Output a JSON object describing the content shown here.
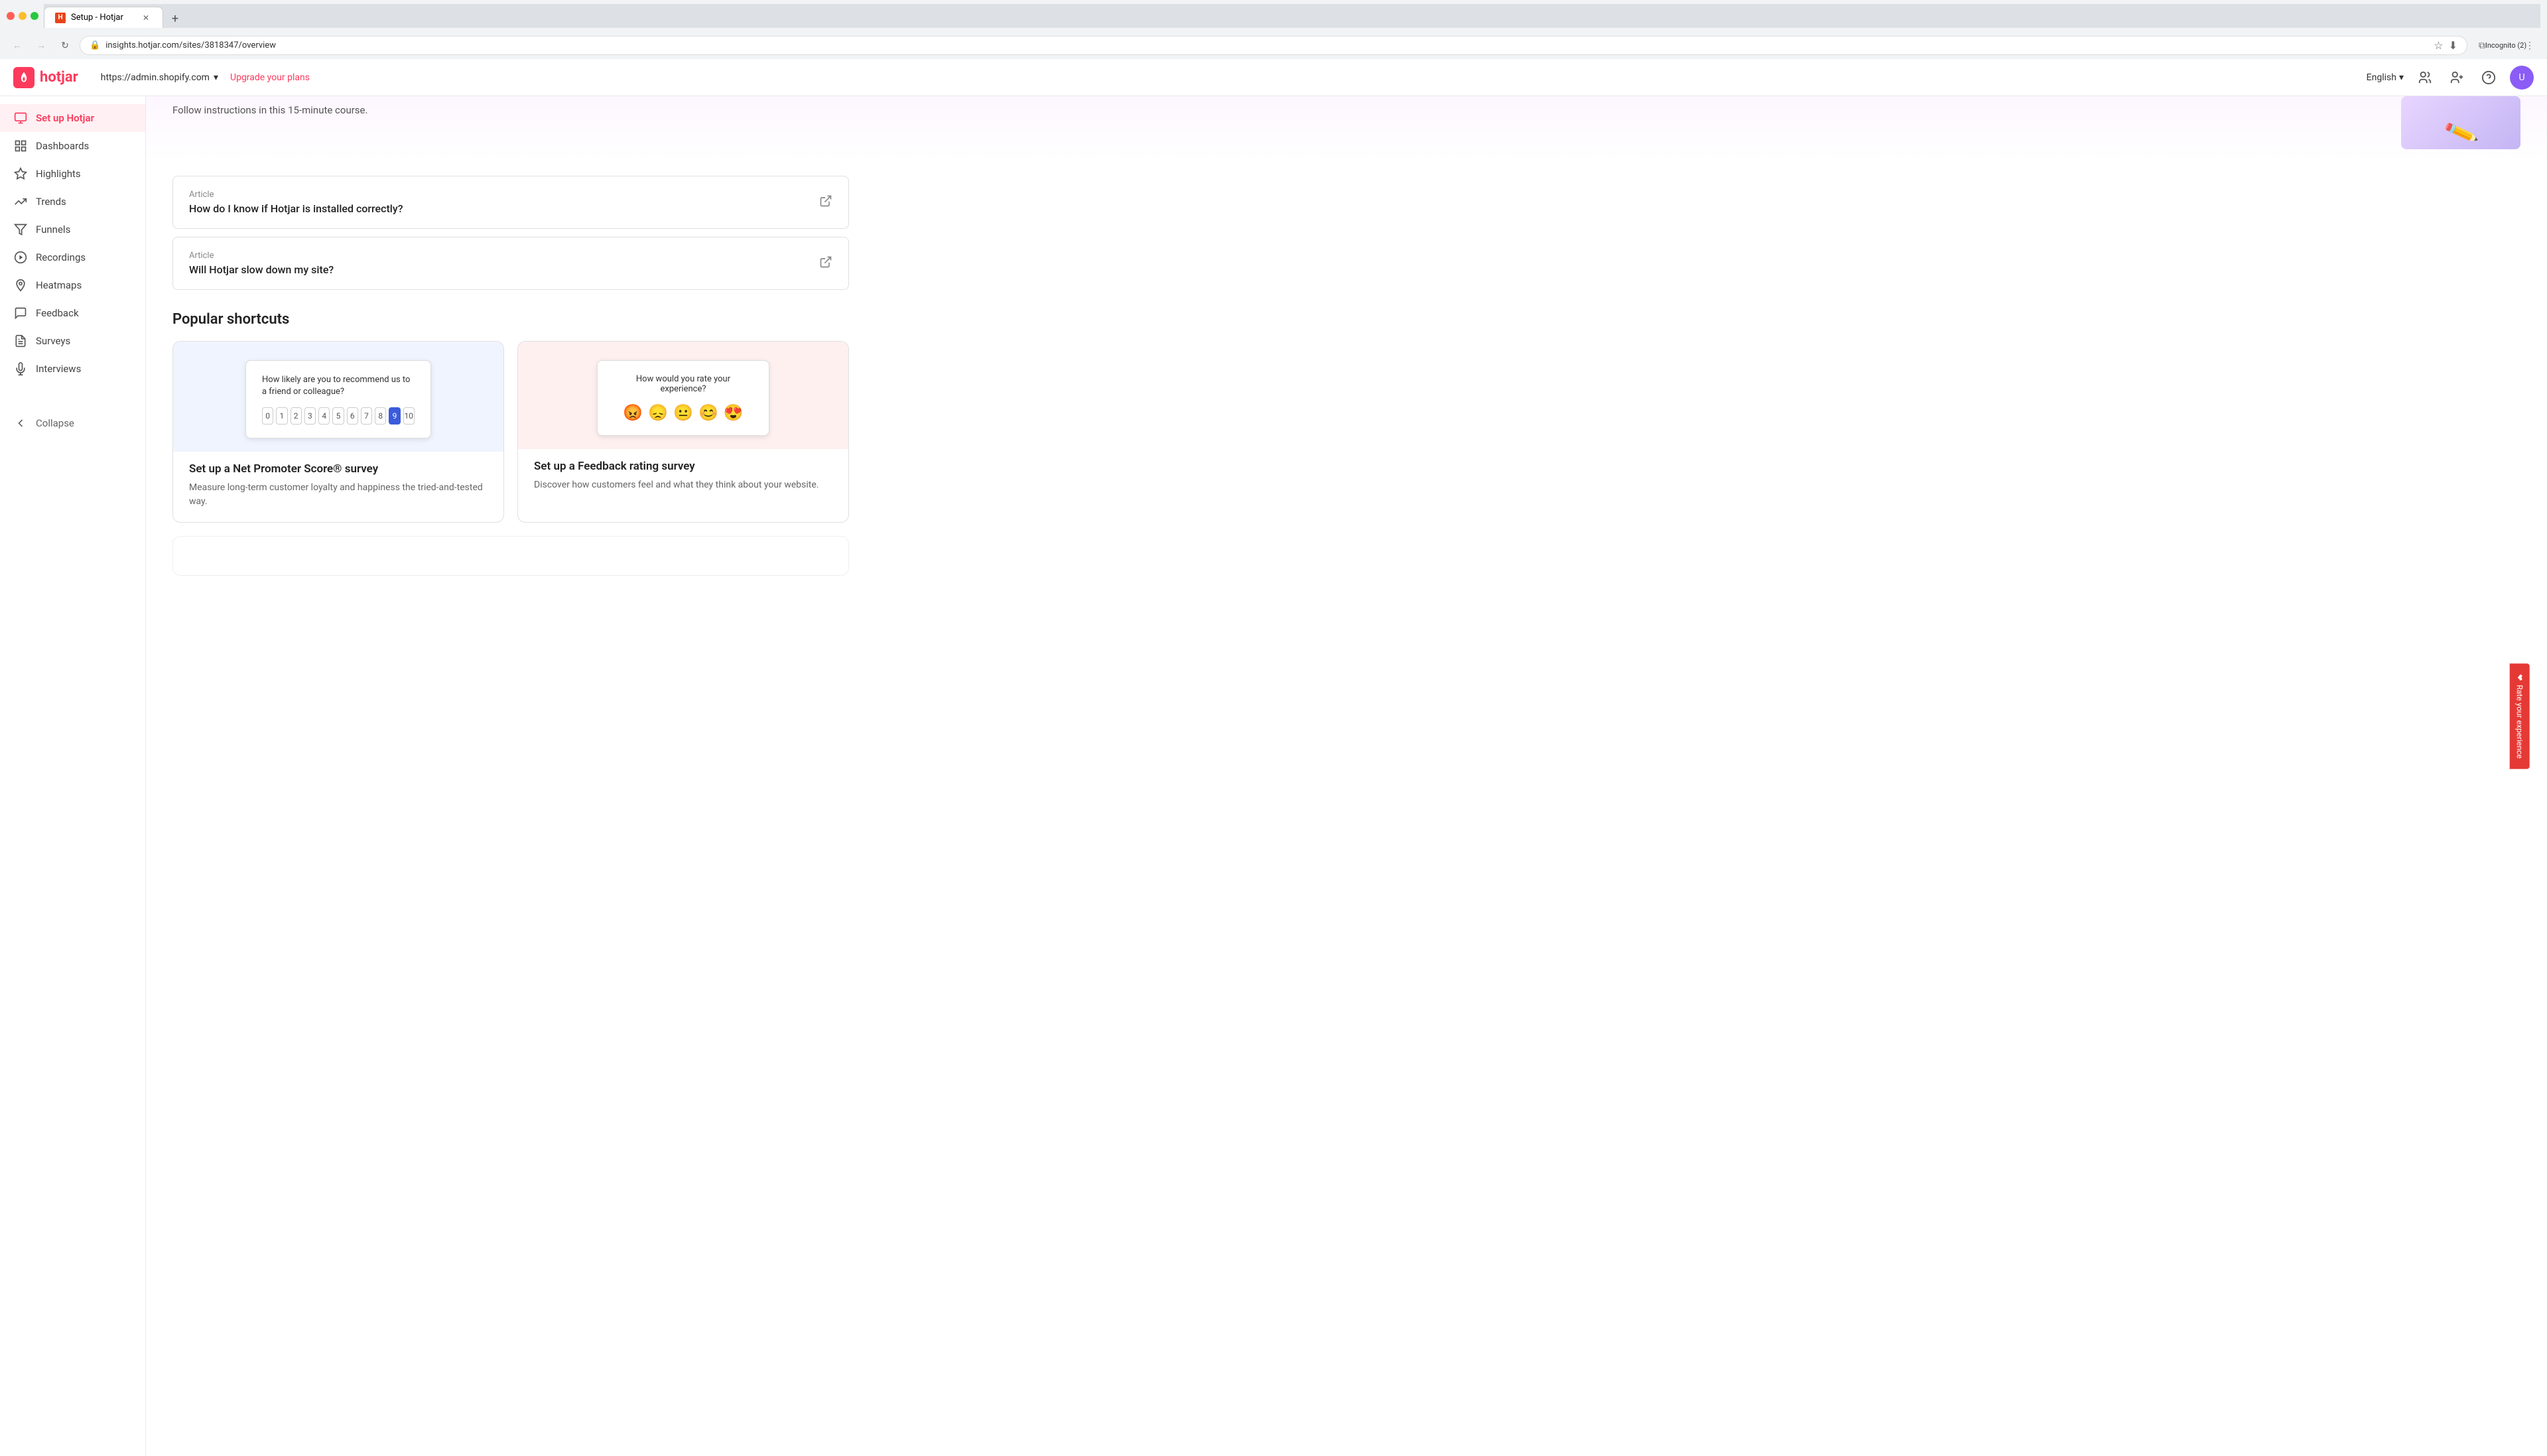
{
  "browser": {
    "tab_title": "Setup - Hotjar",
    "tab_favicon": "H",
    "new_tab_label": "+",
    "url": "insights.hotjar.com/sites/3818347/overview",
    "display_url": "insights.hotjar.com/sites/3818347/overview",
    "nav": {
      "back_icon": "←",
      "forward_icon": "→",
      "reload_icon": "↻"
    },
    "incognito_label": "Incognito (2)"
  },
  "hotjar_topbar": {
    "logo_text": "hotjar",
    "logo_initial": "hj",
    "site_url": "https://admin.shopify.com",
    "site_dropdown_icon": "▾",
    "upgrade_label": "Upgrade your plans",
    "lang_label": "English",
    "lang_dropdown": "▾",
    "icons": {
      "users": "👥",
      "user_add": "👤+",
      "help": "?",
      "avatar_initial": "U"
    }
  },
  "sidebar": {
    "items": [
      {
        "id": "setup",
        "label": "Set up Hotjar",
        "icon": "⚙",
        "active": true
      },
      {
        "id": "dashboards",
        "label": "Dashboards",
        "icon": "▦",
        "active": false
      },
      {
        "id": "highlights",
        "label": "Highlights",
        "icon": "★",
        "active": false
      },
      {
        "id": "trends",
        "label": "Trends",
        "icon": "📈",
        "active": false
      },
      {
        "id": "funnels",
        "label": "Funnels",
        "icon": "⬦",
        "active": false
      },
      {
        "id": "recordings",
        "label": "Recordings",
        "icon": "▶",
        "active": false
      },
      {
        "id": "heatmaps",
        "label": "Heatmaps",
        "icon": "🔥",
        "active": false
      },
      {
        "id": "feedback",
        "label": "Feedback",
        "icon": "💬",
        "active": false
      },
      {
        "id": "surveys",
        "label": "Surveys",
        "icon": "📋",
        "active": false
      },
      {
        "id": "interviews",
        "label": "Interviews",
        "icon": "🎙",
        "active": false
      }
    ],
    "collapse_label": "Collapse",
    "collapse_icon": "←"
  },
  "main": {
    "top_partial_text": "Follow instructions in this 15-minute course.",
    "articles": [
      {
        "id": "article-1",
        "label": "Article",
        "title": "How do I know if Hotjar is installed correctly?",
        "icon": "⬡"
      },
      {
        "id": "article-2",
        "label": "Article",
        "title": "Will Hotjar slow down my site?",
        "icon": "⬡"
      }
    ],
    "shortcuts_heading": "Popular shortcuts",
    "shortcuts": [
      {
        "id": "nps-survey",
        "bg": "nps-bg",
        "title": "Set up a Net Promoter Score® survey",
        "description": "Measure long-term customer loyalty and happiness the tried-and-tested way.",
        "preview_type": "nps"
      },
      {
        "id": "feedback-rating",
        "bg": "feedback-bg",
        "title": "Set up a Feedback rating survey",
        "description": "Discover how customers feel and what they think about your website.",
        "preview_type": "feedback"
      }
    ]
  },
  "nps_widget": {
    "question": "How likely are you to recommend us to a friend or colleague?",
    "numbers": [
      "0",
      "1",
      "2",
      "3",
      "4",
      "5",
      "6",
      "7",
      "8",
      "9",
      "10"
    ],
    "selected_index": 9
  },
  "feedback_widget": {
    "question": "How would you rate your experience?",
    "emojis": [
      "😡",
      "😞",
      "😐",
      "😊",
      "😍"
    ]
  },
  "rate_experience": {
    "label": "Rate your experience",
    "icon": "❤"
  }
}
